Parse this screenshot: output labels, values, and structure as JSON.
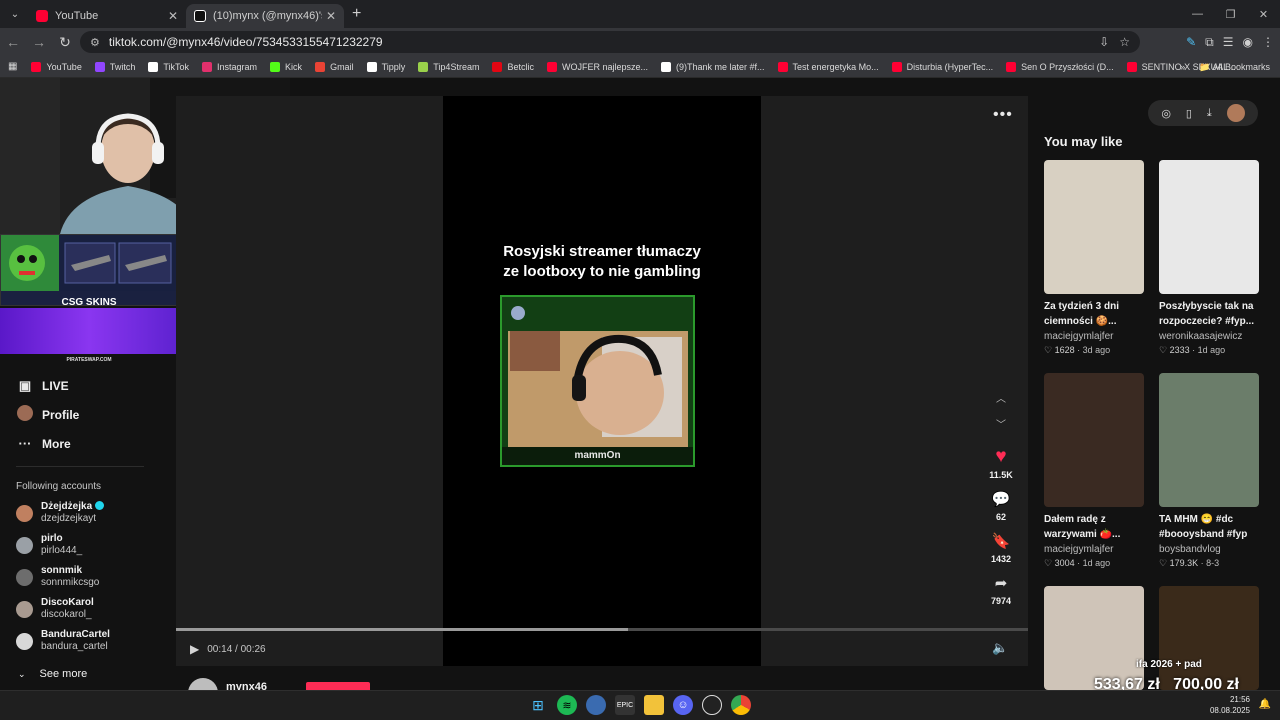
{
  "browser": {
    "tabs": [
      {
        "title": "YouTube",
        "active": false,
        "favicon_color": "#ff0033"
      },
      {
        "title": "(10)mynx (@mynx46)'s videos w",
        "active": true,
        "favicon_color": "#ffffff"
      }
    ],
    "url": "tiktok.com/@mynx46/video/7534533155471232279",
    "bookmarks": [
      {
        "label": "YouTube",
        "color": "#ff0033"
      },
      {
        "label": "Twitch",
        "color": "#9146ff"
      },
      {
        "label": "TikTok",
        "color": "#ffffff"
      },
      {
        "label": "Instagram",
        "color": "#e1306c"
      },
      {
        "label": "Kick",
        "color": "#53fc18"
      },
      {
        "label": "Gmail",
        "color": "#ea4335"
      },
      {
        "label": "Tipply",
        "color": "#ffffff"
      },
      {
        "label": "Tip4Stream",
        "color": "#9ad14b"
      },
      {
        "label": "Betclic",
        "color": "#e30613"
      },
      {
        "label": "WOJFER najlepsze...",
        "color": "#ff0033"
      },
      {
        "label": "(9)Thank me later #f...",
        "color": "#ffffff"
      },
      {
        "label": "Test energetyka Mo...",
        "color": "#ff0033"
      },
      {
        "label": "Disturbia (HyperTec...",
        "color": "#ff0033"
      },
      {
        "label": "Sen O Przyszłości (D...",
        "color": "#ff0033"
      },
      {
        "label": "SENTINO X SEXUAL...",
        "color": "#ff0033"
      }
    ],
    "all_bookmarks": "All Bookmarks"
  },
  "stream_overlay": {
    "skins_label": "CSG SKINS",
    "promo_url": "PIRATESWAP.COM"
  },
  "sidebar": {
    "nav": [
      {
        "label": "LIVE",
        "icon": "live-icon"
      },
      {
        "label": "Profile",
        "icon": "profile-avatar"
      },
      {
        "label": "More",
        "icon": "more-dots-icon"
      }
    ],
    "following_title": "Following accounts",
    "accounts": [
      {
        "name": "Dżejdżejka",
        "handle": "dzejdzejkayt",
        "verified": true,
        "color": "#c08060"
      },
      {
        "name": "pirlo",
        "handle": "pirlo444_",
        "verified": false,
        "color": "#9aa0a6"
      },
      {
        "name": "sonnmik",
        "handle": "sonnmikcsgo",
        "verified": false,
        "color": "#6d6d6d"
      },
      {
        "name": "DiscoKarol",
        "handle": "discokarol_",
        "verified": false,
        "color": "#a89a90"
      },
      {
        "name": "BanduraCartel",
        "handle": "bandura_cartel",
        "verified": false,
        "color": "#d8d8d8"
      }
    ],
    "see_more": "See more"
  },
  "video": {
    "caption": "Rosyjski streamer tłumaczy\nze lootboxy to nie gambling",
    "streamer_tag": "mammOn",
    "likes": "11.5K",
    "comments": "62",
    "saves": "1432",
    "shares": "7974",
    "time": "00:14 / 00:26",
    "progress": 0.53,
    "author": "mynx46"
  },
  "recommendations": {
    "title": "You may like",
    "items": [
      {
        "title": "Za tydzień 3 dni ciemności 🍪...",
        "user": "maciejgymlajfer",
        "likes": "1628",
        "age": "3d ago",
        "bg": "#d8d0c2"
      },
      {
        "title": "Poszłybyscie tak na rozpoczecie? #fyp...",
        "user": "weronikaasajewicz",
        "likes": "2333",
        "age": "1d ago",
        "bg": "#e8e8e8"
      },
      {
        "title": "Dałem radę z warzywami 🍅...",
        "user": "maciejgymlajfer",
        "likes": "3004",
        "age": "1d ago",
        "bg": "#3a2a22"
      },
      {
        "title": "TA MHM 😁 #dc #boooysband #fyp",
        "user": "boysbandvlog",
        "likes": "179.3K",
        "age": "8-3",
        "bg": "#6b7d6a"
      },
      {
        "title": "",
        "user": "",
        "likes": "",
        "age": "",
        "bg": "#cfc4b8"
      },
      {
        "title": "",
        "user": "",
        "likes": "",
        "age": "",
        "bg": "#3a2a1a"
      }
    ]
  },
  "overlay_texts": {
    "promo": "ifa 2026 + pad",
    "wallet": "533,67 zł   700,00 zł"
  },
  "taskbar": {
    "time": "21:56",
    "date": "08.08.2025"
  }
}
